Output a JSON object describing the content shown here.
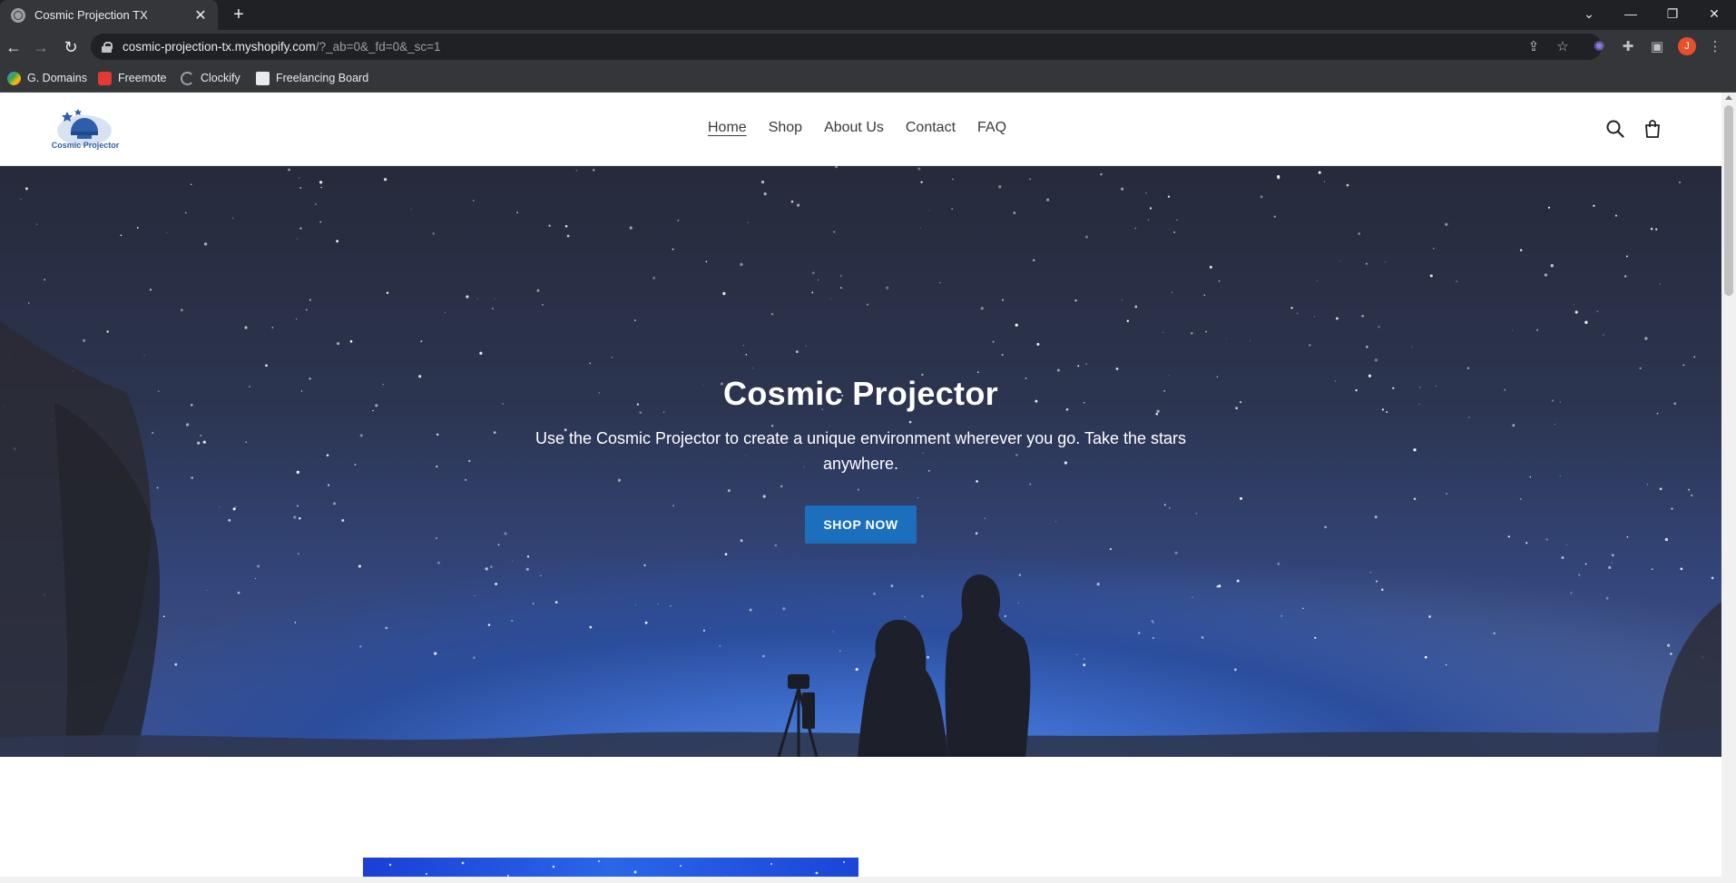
{
  "browser": {
    "tab_title": "Cosmic Projection TX",
    "tab_close": "✕",
    "new_tab": "+",
    "url_host": "cosmic-projection-tx.myshopify.com",
    "url_path": "/?_ab=0&_fd=0&_sc=1",
    "profile_initial": "J",
    "bookmarks": [
      {
        "label": "G. Domains",
        "color": "#f4b400"
      },
      {
        "label": "Freemote",
        "color": "#e53935"
      },
      {
        "label": "Clockify",
        "color": "#5f6368"
      },
      {
        "label": "Freelancing Board",
        "color": "#e8eaed"
      }
    ]
  },
  "site": {
    "logo_text": "Cosmic Projector",
    "nav": [
      {
        "label": "Home",
        "active": true
      },
      {
        "label": "Shop"
      },
      {
        "label": "About Us"
      },
      {
        "label": "Contact"
      },
      {
        "label": "FAQ"
      }
    ],
    "hero": {
      "title": "Cosmic Projector",
      "subtitle": "Use the Cosmic Projector to create a unique environment wherever you go. Take the stars anywhere.",
      "button": "SHOP NOW"
    }
  },
  "colors": {
    "accent_button": "#1b6fbd",
    "browser_bg": "#35363a",
    "tabbar_bg": "#202124"
  }
}
